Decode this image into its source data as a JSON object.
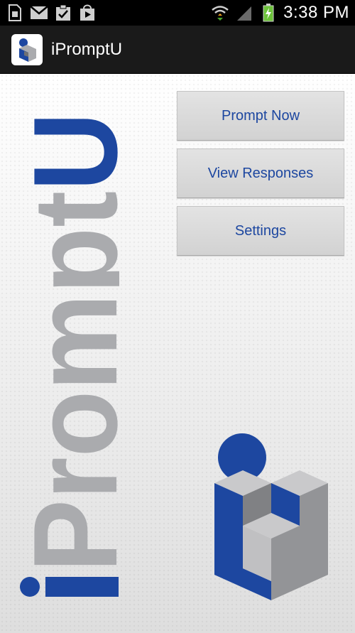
{
  "status_bar": {
    "time": "3:38 PM",
    "icons": [
      "sim-card-icon",
      "gmail-icon",
      "tasks-icon",
      "play-store-icon",
      "wifi-icon",
      "signal-icon",
      "battery-charging-icon"
    ]
  },
  "action_bar": {
    "title": "iPromptU",
    "icon": "app-logo-icon"
  },
  "main": {
    "brand_wordmark": "iPromptU",
    "buttons": [
      {
        "label": "Prompt Now"
      },
      {
        "label": "View Responses"
      },
      {
        "label": "Settings"
      }
    ]
  },
  "colors": {
    "brand_blue": "#1d47a0",
    "logo_gray": "#aaabae",
    "action_bar": "#1a1a1a"
  }
}
